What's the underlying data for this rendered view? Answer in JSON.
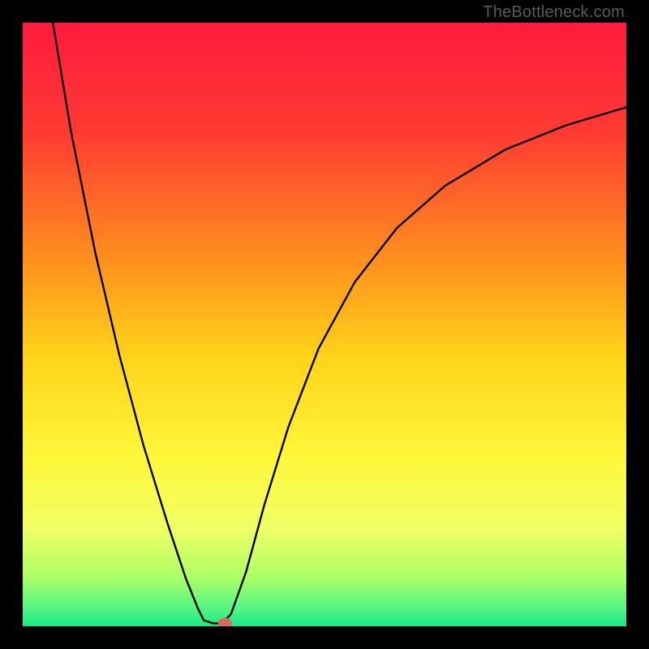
{
  "watermark": "TheBottleneck.com",
  "chart_data": {
    "type": "line",
    "title": "",
    "xlabel": "",
    "ylabel": "",
    "xlim": [
      0,
      100
    ],
    "ylim": [
      0,
      100
    ],
    "grid": false,
    "legend": false,
    "background_gradient": {
      "stops": [
        {
          "offset": 0.0,
          "color": "#ff1a3d"
        },
        {
          "offset": 0.18,
          "color": "#ff3a33"
        },
        {
          "offset": 0.38,
          "color": "#ff8a1f"
        },
        {
          "offset": 0.55,
          "color": "#ffd21a"
        },
        {
          "offset": 0.72,
          "color": "#fff73a"
        },
        {
          "offset": 0.84,
          "color": "#f0ff66"
        },
        {
          "offset": 0.92,
          "color": "#aaff66"
        },
        {
          "offset": 0.97,
          "color": "#55f585"
        },
        {
          "offset": 1.0,
          "color": "#18e884"
        }
      ]
    },
    "series": [
      {
        "name": "curve",
        "color": "#000000",
        "points": [
          {
            "x": 5.0,
            "y": 100.0
          },
          {
            "x": 8.0,
            "y": 82.0
          },
          {
            "x": 12.0,
            "y": 62.0
          },
          {
            "x": 16.0,
            "y": 45.0
          },
          {
            "x": 20.0,
            "y": 30.0
          },
          {
            "x": 24.0,
            "y": 17.0
          },
          {
            "x": 27.0,
            "y": 8.0
          },
          {
            "x": 29.0,
            "y": 3.0
          },
          {
            "x": 30.0,
            "y": 1.0
          },
          {
            "x": 31.5,
            "y": 0.5
          },
          {
            "x": 33.0,
            "y": 0.5
          },
          {
            "x": 34.5,
            "y": 2.0
          },
          {
            "x": 37.0,
            "y": 9.0
          },
          {
            "x": 40.0,
            "y": 20.0
          },
          {
            "x": 44.0,
            "y": 33.0
          },
          {
            "x": 49.0,
            "y": 46.0
          },
          {
            "x": 55.0,
            "y": 57.0
          },
          {
            "x": 62.0,
            "y": 66.0
          },
          {
            "x": 70.0,
            "y": 73.0
          },
          {
            "x": 80.0,
            "y": 79.0
          },
          {
            "x": 90.0,
            "y": 83.0
          },
          {
            "x": 100.0,
            "y": 86.0
          }
        ]
      }
    ],
    "marker": {
      "x": 33.5,
      "y": 0.5,
      "color": "#d96a5a",
      "r": 1.2
    }
  }
}
